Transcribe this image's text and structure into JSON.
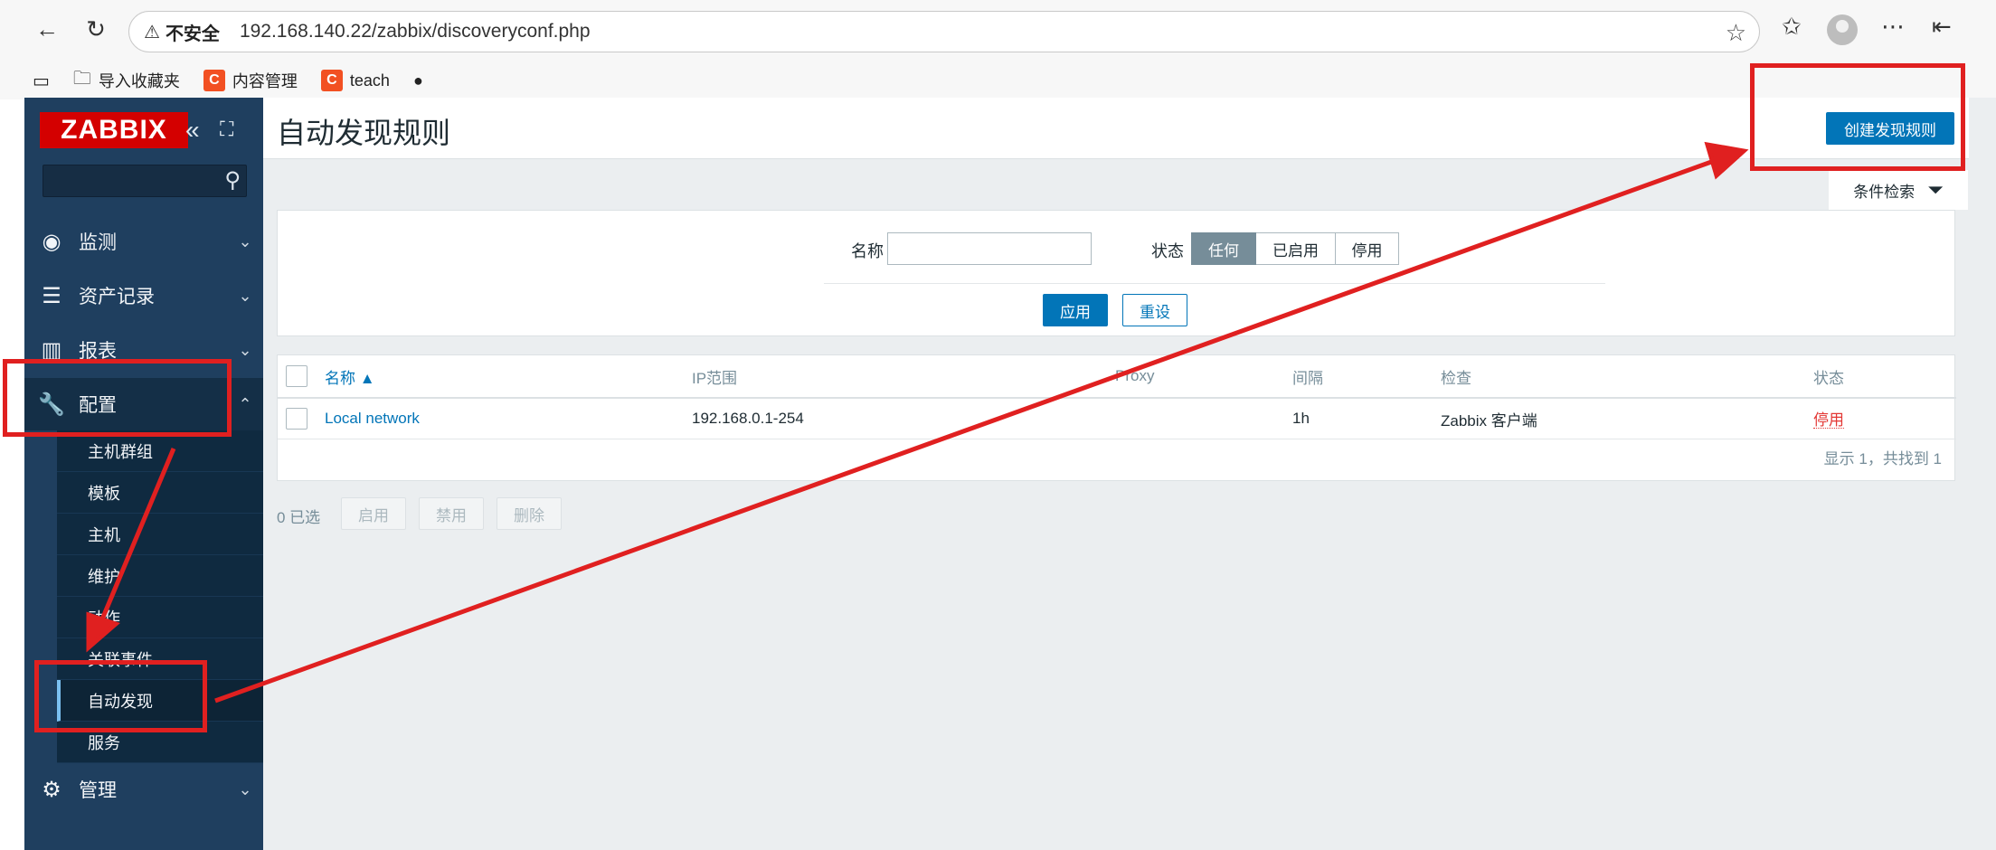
{
  "browser": {
    "security_label": "不安全",
    "url": "192.168.140.22/zabbix/discoveryconf.php",
    "bookmarks": [
      "导入收藏夹",
      "内容管理",
      "teach"
    ]
  },
  "sidebar": {
    "logo": "ZABBIX",
    "search_placeholder": "",
    "menu": [
      {
        "label": "监测"
      },
      {
        "label": "资产记录"
      },
      {
        "label": "报表"
      },
      {
        "label": "配置"
      },
      {
        "label": "管理"
      }
    ],
    "submenu": [
      "主机群组",
      "模板",
      "主机",
      "维护",
      "动作",
      "关联事件",
      "自动发现",
      "服务"
    ]
  },
  "header": {
    "title": "自动发现规则",
    "create_button": "创建发现规则"
  },
  "filter": {
    "tab_label": "条件检索",
    "name_label": "名称",
    "name_value": "",
    "status_label": "状态",
    "status_options": [
      "任何",
      "已启用",
      "停用"
    ],
    "apply": "应用",
    "reset": "重设"
  },
  "table": {
    "columns": [
      "名称 ▲",
      "IP范围",
      "Proxy",
      "间隔",
      "检查",
      "状态"
    ],
    "rows": [
      {
        "name": "Local network",
        "ip_range": "192.168.0.1-254",
        "proxy": "",
        "interval": "1h",
        "checks": "Zabbix 客户端",
        "status": "停用"
      }
    ],
    "paging": "显示 1，共找到 1"
  },
  "actions": {
    "selected": "0 已选",
    "enable": "启用",
    "disable": "禁用",
    "delete": "删除"
  },
  "colors": {
    "sidebar_bg": "#1f3f5f",
    "accent": "#0275b8",
    "annotation": "#e02020",
    "status_disabled": "#e33734"
  }
}
